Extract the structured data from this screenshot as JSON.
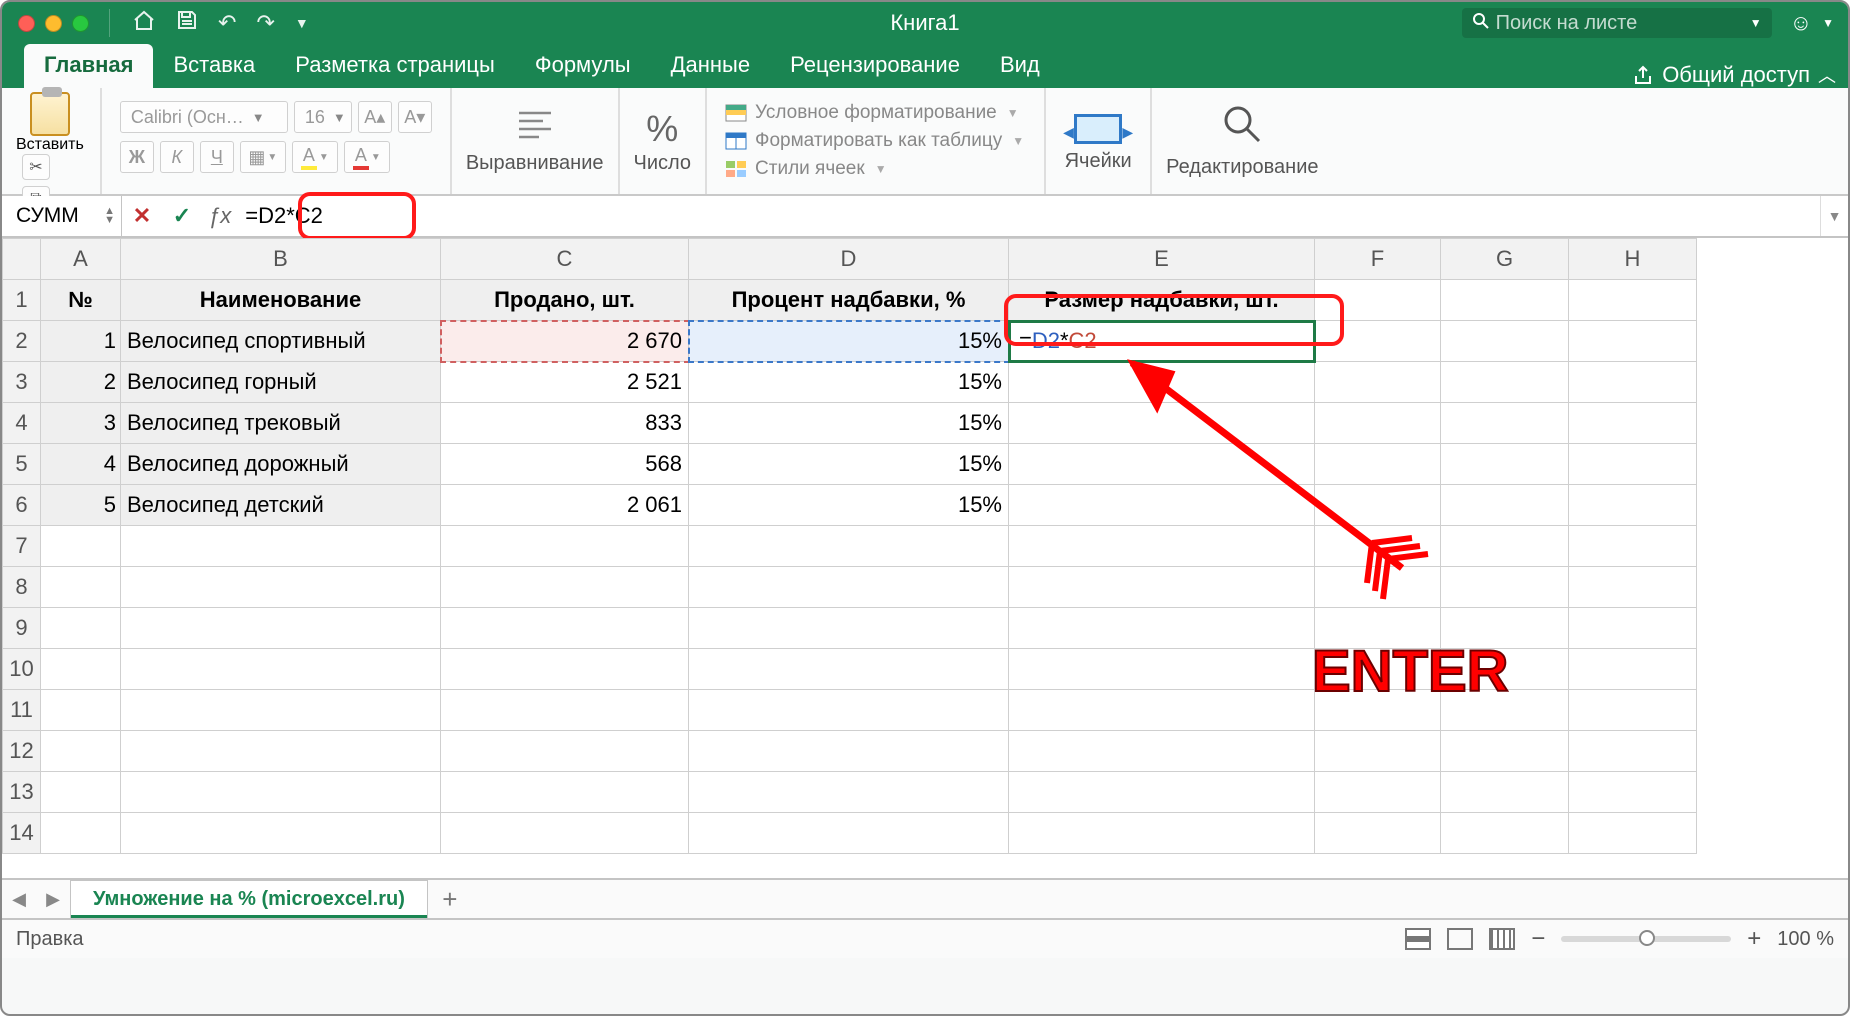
{
  "title": "Книга1",
  "search_placeholder": "Поиск на листе",
  "tabs": [
    "Главная",
    "Вставка",
    "Разметка страницы",
    "Формулы",
    "Данные",
    "Рецензирование",
    "Вид"
  ],
  "share": "Общий доступ",
  "ribbon": {
    "paste": "Вставить",
    "font_name": "Calibri (Осн…",
    "font_size": "16",
    "align": "Выравнивание",
    "number": "Число",
    "cond_fmt": "Условное форматирование",
    "as_table": "Форматировать как таблицу",
    "cell_styles": "Стили ячеек",
    "cells": "Ячейки",
    "editing": "Редактирование"
  },
  "namebox": "СУММ",
  "formula": "=D2*C2",
  "formula_parts": {
    "eq": "=",
    "r1": "D2",
    "op": "*",
    "r2": "C2"
  },
  "columns": [
    "A",
    "B",
    "C",
    "D",
    "E",
    "F",
    "G",
    "H"
  ],
  "headers": {
    "a": "№",
    "b": "Наименование",
    "c": "Продано, шт.",
    "d": "Процент надбавки, %",
    "e": "Размер надбавки, шт."
  },
  "rows": [
    {
      "n": "1",
      "name": "Велосипед спортивный",
      "sold": "2 670",
      "pct": "15%"
    },
    {
      "n": "2",
      "name": "Велосипед горный",
      "sold": "2 521",
      "pct": "15%"
    },
    {
      "n": "3",
      "name": "Велосипед трековый",
      "sold": "833",
      "pct": "15%"
    },
    {
      "n": "4",
      "name": "Велосипед дорожный",
      "sold": "568",
      "pct": "15%"
    },
    {
      "n": "5",
      "name": "Велосипед детский",
      "sold": "2 061",
      "pct": "15%"
    }
  ],
  "sheet_name": "Умножение на % (microexcel.ru)",
  "status": "Правка",
  "zoom": "100 %",
  "annotation": "ENTER"
}
